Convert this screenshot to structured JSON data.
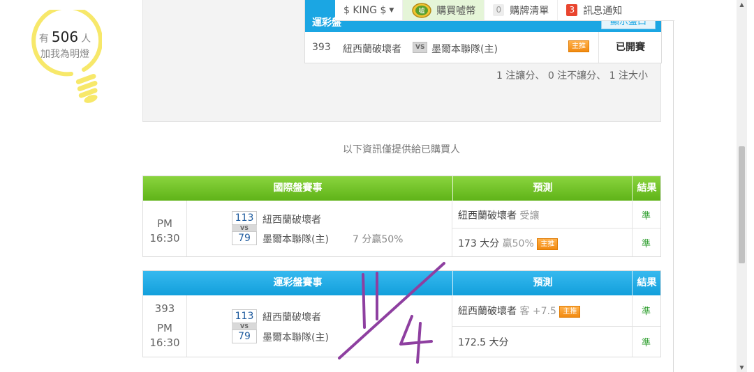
{
  "left_panel": {
    "bulb_prefix": "有",
    "bulb_count": "506",
    "bulb_suffix": "人",
    "bulb_action": "加我為明燈"
  },
  "topbar": {
    "user_label": "$ KING $",
    "buy_coin_label": "購買噓幣",
    "coin_icon_text": "噓",
    "cart_count": "0",
    "cart_label": "購牌清單",
    "notify_count": "3",
    "notify_label": "訊息通知"
  },
  "top_card": {
    "header_label": "運彩盤",
    "header_button": "顯示盤口",
    "row": {
      "code": "393",
      "home_team": "紐西蘭破壞者",
      "vs": "VS",
      "away_team": "墨爾本聯隊(主)",
      "tag": "主推",
      "status": "已開賽"
    },
    "summary": "1 注讓分、 0 注不讓分、 1 注大小"
  },
  "notice": "以下資訊僅提供給已購買人",
  "international": {
    "headers": {
      "match": "國際盤賽事",
      "prediction": "預測",
      "result": "結果"
    },
    "time_ampm": "PM",
    "time_clock": "16:30",
    "score_home": "113",
    "score_vs": "VS",
    "score_away": "79",
    "home_team": "紐西蘭破壞者",
    "away_team": "墨爾本聯隊(主)",
    "extra": "7 分贏50%",
    "pred1_team": "紐西蘭破壞者",
    "pred1_note": "受讓",
    "pred2_main": "173 大分",
    "pred2_note": "贏50%",
    "pred_tag": "主推",
    "result1": "準",
    "result2": "準"
  },
  "lottery": {
    "headers": {
      "match": "運彩盤賽事",
      "prediction": "預測",
      "result": "結果"
    },
    "code": "393",
    "time_ampm": "PM",
    "time_clock": "16:30",
    "score_home": "113",
    "score_vs": "VS",
    "score_away": "79",
    "home_team": "紐西蘭破壞者",
    "away_team": "墨爾本聯隊(主)",
    "pred1_team": "紐西蘭破壞者",
    "pred1_note": "客 +7.5",
    "pred_tag": "主推",
    "pred2_main": "172.5 大分",
    "result1": "準",
    "result2": "準"
  },
  "colors": {
    "green_header": "#6cbf22",
    "blue_header": "#1ba6e3",
    "bulb_yellow": "#f7e86a",
    "annotation_purple": "#8e3fa0",
    "result_green": "#2e9e2e"
  },
  "icons": [
    "lightbulb-icon",
    "coin-icon",
    "caret-down-icon",
    "scroll-up-icon",
    "scroll-down-icon"
  ]
}
